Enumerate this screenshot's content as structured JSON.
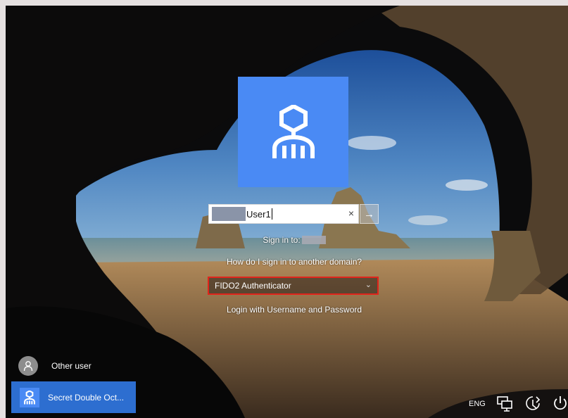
{
  "login": {
    "username_value": "User1",
    "clear_glyph": "×",
    "submit_glyph": "→",
    "signin_label": "Sign in to:",
    "other_domain_link": "How do I sign in to another domain?",
    "auth_option": "FIDO2 Authenticator",
    "auth_chevron": "⌄",
    "login_link": "Login with Username and Password"
  },
  "users": {
    "other_user": "Other user",
    "current_user": "Secret Double Oct..."
  },
  "tray": {
    "language": "ENG"
  },
  "icons": {
    "tile": "octopus-logo-icon",
    "other_avatar": "person-icon",
    "network": "network-icon",
    "ease": "ease-of-access-icon",
    "power": "power-icon"
  },
  "colors": {
    "tile": "#4a8af4",
    "selected_user": "#2d6ed0",
    "dropdown_border": "#e0241b"
  }
}
